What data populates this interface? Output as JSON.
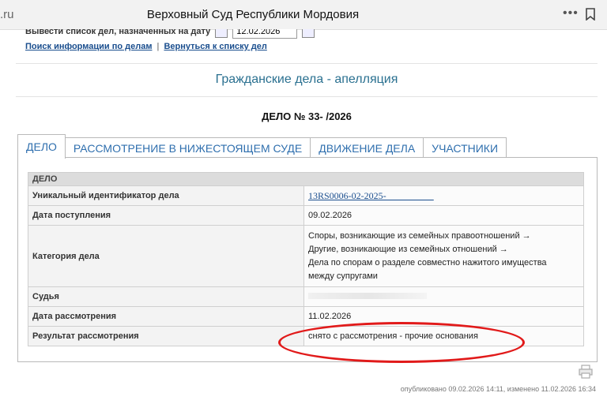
{
  "browser": {
    "domain": ".ru",
    "title": "Верховный Суд Республики Мордовия",
    "menu_glyph": "•••"
  },
  "filter": {
    "label": "Вывести список дел, назначенных на дату",
    "date": "12.02.2026"
  },
  "links": {
    "search": "Поиск информации по делам",
    "separator": "|",
    "back": "Вернуться к списку дел"
  },
  "section_title": "Гражданские дела - апелляция",
  "case_number": "ДЕЛО № 33-      /2026",
  "tabs": [
    {
      "label": "ДЕЛО",
      "active": true
    },
    {
      "label": "РАССМОТРЕНИЕ В НИЖЕСТОЯЩЕМ СУДЕ",
      "active": false
    },
    {
      "label": "ДВИЖЕНИЕ ДЕЛА",
      "active": false
    },
    {
      "label": "УЧАСТНИКИ",
      "active": false
    }
  ],
  "table": {
    "header": "ДЕЛО",
    "rows": {
      "uid": {
        "label": "Уникальный идентификатор дела",
        "value": "13RS0006-02-2025-__________"
      },
      "received": {
        "label": "Дата поступления",
        "value": "09.02.2026"
      },
      "category": {
        "label": "Категория дела",
        "lines": [
          "Споры, возникающие из семейных правоотношений →",
          "Другие, возникающие из семейных отношений →",
          "Дела по спорам о разделе совместно нажитого имущества",
          "между супругами"
        ]
      },
      "judge": {
        "label": "Судья",
        "value": ""
      },
      "review_date": {
        "label": "Дата рассмотрения",
        "value": "11.02.2026"
      },
      "result": {
        "label": "Результат рассмотрения",
        "value": "снято с рассмотрения - прочие основания"
      }
    }
  },
  "footer": "опубликовано 09.02.2026 14:11, изменено 11.02.2026 16:34",
  "colors": {
    "accent": "#2f6fae",
    "highlight": "#e11a1a",
    "title": "#2a7090"
  },
  "icons": {
    "menu": "more-icon",
    "bookmark": "bookmark-icon",
    "calendar": "calendar-icon",
    "print": "printer-icon"
  }
}
